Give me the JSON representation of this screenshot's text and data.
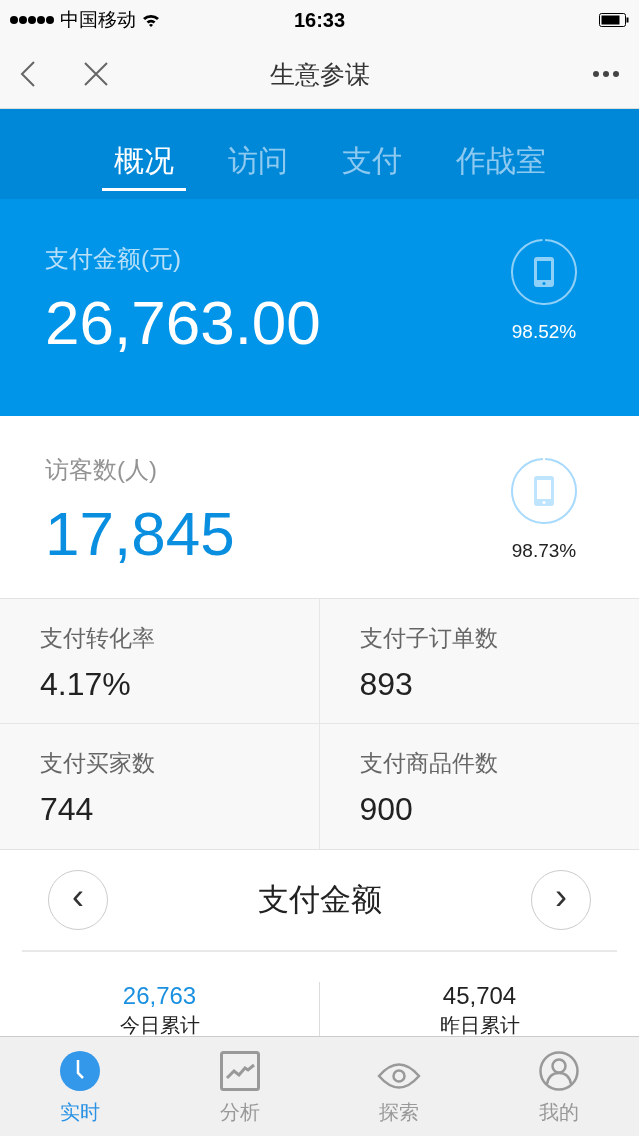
{
  "status_bar": {
    "carrier": "中国移动",
    "time": "16:33"
  },
  "nav": {
    "title": "生意参谋"
  },
  "tabs": [
    {
      "label": "概况",
      "selected": true
    },
    {
      "label": "访问",
      "selected": false
    },
    {
      "label": "支付",
      "selected": false
    },
    {
      "label": "作战室",
      "selected": false
    }
  ],
  "highlights": [
    {
      "label": "支付金额(元)",
      "value": "26,763.00",
      "level": 0.9852,
      "reading": "98.52%",
      "kind": "primary"
    },
    {
      "label": "访客数(人)",
      "value": "17,845",
      "level": 0.9873,
      "reading": "98.73%",
      "kind": "secondary"
    }
  ],
  "metrics": [
    {
      "label": "支付转化率",
      "value": "4.17%"
    },
    {
      "label": "支付子订单数",
      "value": "893"
    },
    {
      "label": "支付买家数",
      "value": "744"
    },
    {
      "label": "支付商品件数",
      "value": "900"
    }
  ],
  "chart_header": {
    "prev": "‹",
    "title": "支付金额",
    "next": "›"
  },
  "totals": [
    {
      "value": "26,763",
      "label": "今日累计",
      "selected": true
    },
    {
      "value": "45,704",
      "label": "昨日累计",
      "selected": false
    }
  ],
  "tab_bar": [
    {
      "label": "实时",
      "kind": "clock",
      "selected": true
    },
    {
      "label": "分析",
      "kind": "chart",
      "selected": false
    },
    {
      "label": "探索",
      "kind": "eye",
      "selected": false
    },
    {
      "label": "我的",
      "kind": "user",
      "selected": false
    }
  ]
}
